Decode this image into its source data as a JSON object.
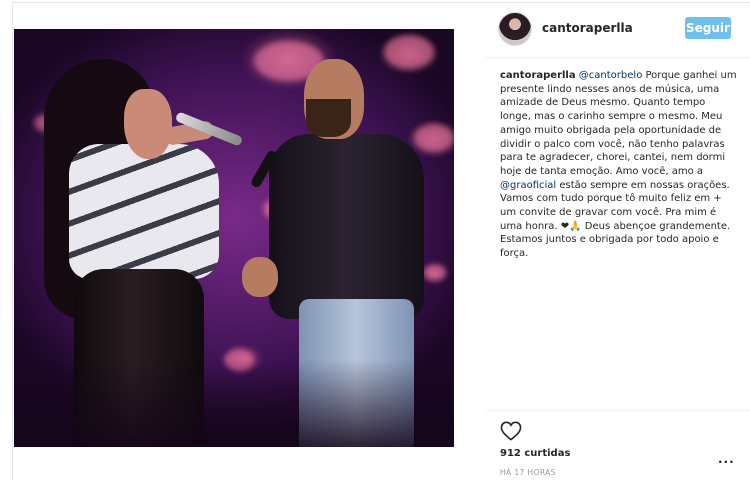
{
  "post": {
    "username": "cantoraperlla",
    "follow_label": "Seguir",
    "caption": {
      "author": "cantoraperlla",
      "mention1": "@cantorbelo",
      "text1": " Porque ganhei um presente lindo nesses anos de música, uma amizade de Deus mesmo. Quanto tempo longe, mas o carinho sempre o mesmo. Meu amigo muito obrigada pela oportunidade de dividir o palco com você, não tenho palavras para te agradecer, chorei, cantei, nem dormi hoje de tanta emoção. Amo você, amo a ",
      "mention2": "@graoficial",
      "text2": " estão sempre em nossas orações. Vamos com tudo porque tô muito feliz em + um convite de gravar com você. Pra mim é uma honra. ❤🙏 Deus abençoe grandemente. Estamos juntos e obrigada por todo apoio e força."
    },
    "likes": "912 curtidas",
    "time": "HÁ 17 HORAS",
    "more": "..."
  },
  "icons": {
    "like": "heart-outline-icon",
    "more": "ellipsis-icon"
  },
  "colors": {
    "follow_button": "#70c0ef",
    "mention": "#003569"
  }
}
